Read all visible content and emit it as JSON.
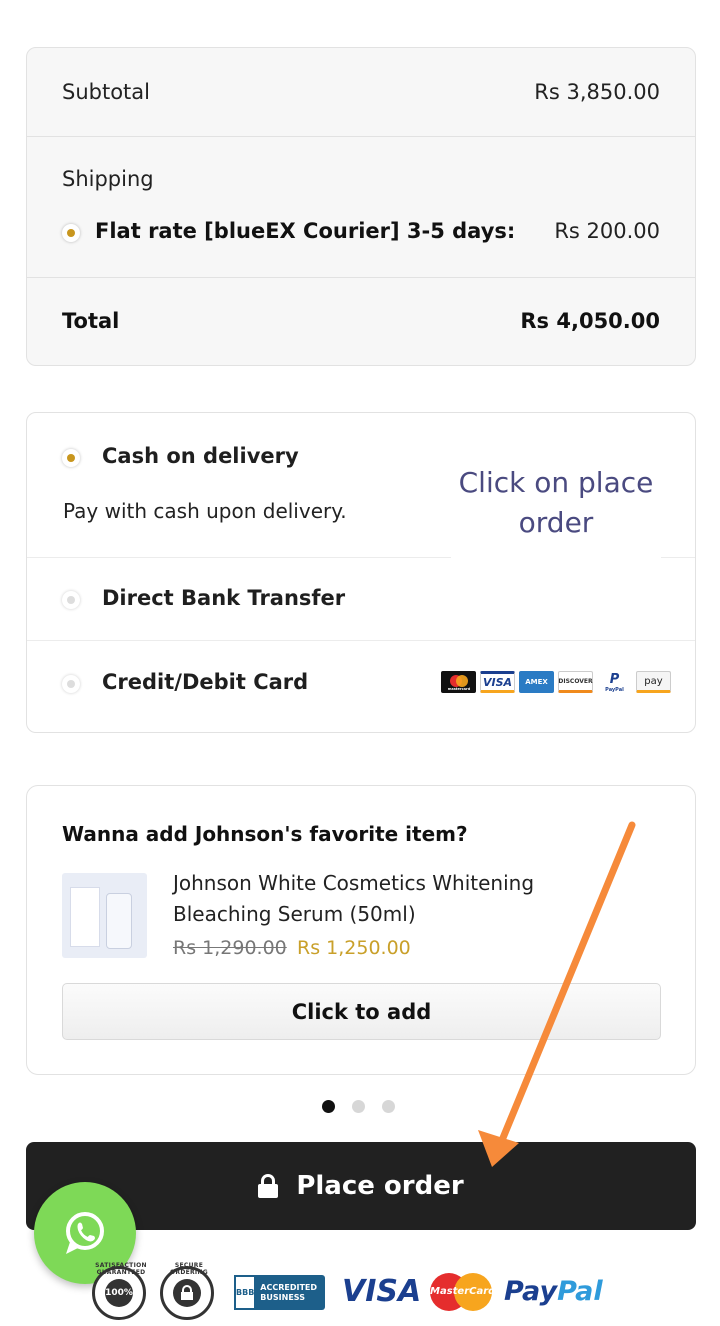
{
  "totals": {
    "subtotal_label": "Subtotal",
    "subtotal_value": "Rs 3,850.00",
    "shipping_label": "Shipping",
    "shipping_method": "Flat rate [blueEX Courier] 3-5 days:",
    "shipping_value": "Rs 200.00",
    "total_label": "Total",
    "total_value": "Rs 4,050.00"
  },
  "payment": {
    "options": [
      {
        "label": "Cash on delivery",
        "selected": true,
        "description": "Pay with cash upon delivery."
      },
      {
        "label": "Direct Bank Transfer",
        "selected": false
      },
      {
        "label": "Credit/Debit Card",
        "selected": false
      }
    ],
    "card_icons": [
      {
        "name": "mastercard-icon",
        "text": "mastercard"
      },
      {
        "name": "visa-icon",
        "text": "VISA"
      },
      {
        "name": "amex-icon",
        "text": "AMEX"
      },
      {
        "name": "discover-icon",
        "text": "DISCOVER"
      },
      {
        "name": "paypal-icon",
        "text": "PayPal"
      },
      {
        "name": "amazon-pay-icon",
        "text": "pay"
      }
    ]
  },
  "annotation": {
    "note": "Click on place order",
    "arrow_color": "#f68a3a"
  },
  "upsell": {
    "title": "Wanna add Johnson's favorite item?",
    "product_name": "Johnson White Cosmetics Whitening Bleaching Serum (50ml)",
    "old_price": "Rs 1,290.00",
    "new_price": "Rs 1,250.00",
    "button_label": "Click to add",
    "carousel_active_index": 0,
    "carousel_count": 3
  },
  "checkout": {
    "place_order_label": "Place order"
  },
  "trust_badges": {
    "satisfaction": "100%",
    "satisfaction_text": "SATISFACTION GUARANTEED",
    "secure_text": "SECURE ORDERING",
    "bbb_left": "BBB",
    "bbb_right": "ACCREDITED BUSINESS",
    "visa": "VISA",
    "mastercard": "MasterCard",
    "paypal_a": "Pay",
    "paypal_b": "Pal"
  },
  "colors": {
    "accent_gold": "#c8961e",
    "button_dark": "#212121",
    "whatsapp_green": "#7ed957"
  }
}
